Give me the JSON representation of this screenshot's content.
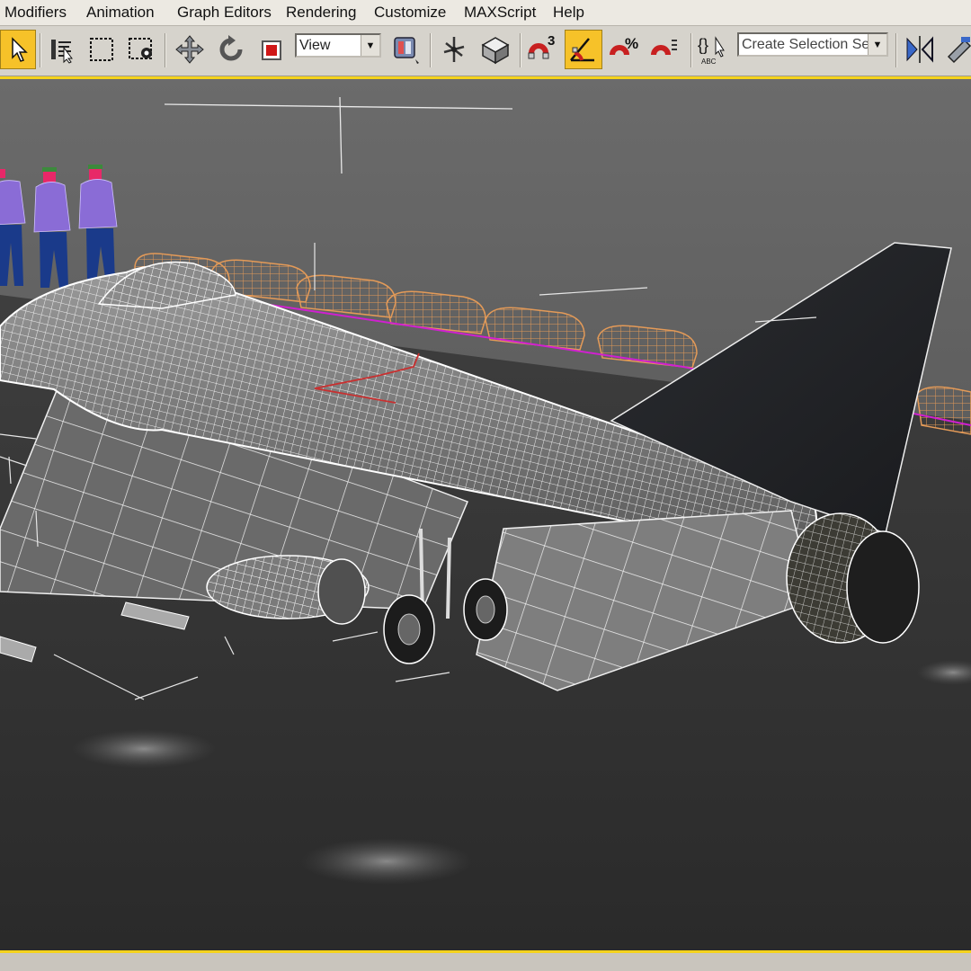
{
  "menubar": {
    "items": [
      "Modifiers",
      "Animation",
      "Graph Editors",
      "Rendering",
      "Customize",
      "MAXScript",
      "Help"
    ]
  },
  "toolbar": {
    "view_dropdown": "View",
    "snap_value": "3",
    "selection_set_placeholder": "Create Selection Set",
    "named_selection_label": "ABC",
    "active_color": "#f6c229"
  },
  "viewport": {
    "border_color": "#f4d21c",
    "active": true
  }
}
